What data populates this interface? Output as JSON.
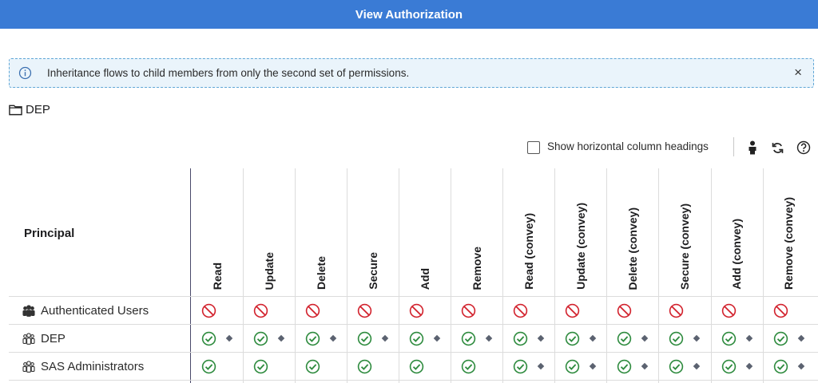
{
  "title": "View Authorization",
  "info": {
    "text": "Inheritance flows to child members from only the second set of permissions.",
    "close_label": "×"
  },
  "breadcrumb": {
    "label": "DEP"
  },
  "toolbar": {
    "show_horizontal_label": "Show horizontal column headings"
  },
  "table": {
    "principal_header": "Principal",
    "columns": [
      "Read",
      "Update",
      "Delete",
      "Secure",
      "Add",
      "Remove",
      "Read (convey)",
      "Update (convey)",
      "Delete (convey)",
      "Secure (convey)",
      "Add (convey)",
      "Remove (convey)"
    ],
    "rows": [
      {
        "name": "Authenticated Users",
        "icon": "group-filled-icon",
        "cells": [
          "deny",
          "deny",
          "deny",
          "deny",
          "deny",
          "deny",
          "deny",
          "deny",
          "deny",
          "deny",
          "deny",
          "deny"
        ],
        "inherited": [
          false,
          false,
          false,
          false,
          false,
          false,
          false,
          false,
          false,
          false,
          false,
          false
        ]
      },
      {
        "name": "DEP",
        "icon": "group-outline-icon",
        "cells": [
          "grant",
          "grant",
          "grant",
          "grant",
          "grant",
          "grant",
          "grant",
          "grant",
          "grant",
          "grant",
          "grant",
          "grant"
        ],
        "inherited": [
          true,
          true,
          true,
          true,
          true,
          true,
          true,
          true,
          true,
          true,
          true,
          true
        ]
      },
      {
        "name": "SAS Administrators",
        "icon": "group-outline-icon",
        "cells": [
          "grant",
          "grant",
          "grant",
          "grant",
          "grant",
          "grant",
          "grant",
          "grant",
          "grant",
          "grant",
          "grant",
          "grant"
        ],
        "inherited": [
          false,
          false,
          false,
          false,
          false,
          false,
          true,
          true,
          true,
          true,
          true,
          true
        ]
      }
    ]
  },
  "colors": {
    "titlebar": "#3a7bd5",
    "grant": "#2e8b3e",
    "deny": "#d2222d",
    "info_bg": "#eaf4fb"
  }
}
